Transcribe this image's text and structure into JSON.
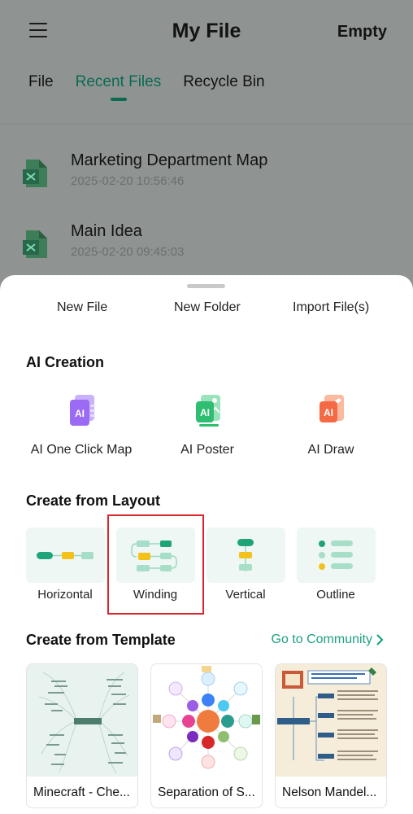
{
  "header": {
    "title": "My File",
    "empty_label": "Empty",
    "menu_icon": "menu-icon"
  },
  "tabs": [
    {
      "label": "File",
      "active": false
    },
    {
      "label": "Recent Files",
      "active": true
    },
    {
      "label": "Recycle Bin",
      "active": false
    }
  ],
  "files": [
    {
      "name": "Marketing Department Map",
      "time": "2025-02-20 10:56:46",
      "icon": "mindmap-file-icon"
    },
    {
      "name": "Main Idea",
      "time": "2025-02-20 09:45:03",
      "icon": "mindmap-file-icon"
    }
  ],
  "sheet": {
    "actions": {
      "new_file": "New File",
      "new_folder": "New Folder",
      "import": "Import File(s)"
    },
    "ai_creation": {
      "title": "AI Creation",
      "items": [
        {
          "label": "AI One Click Map",
          "icon": "ai-one-click-map-icon",
          "badge": "AI",
          "color": "#8a5cf0"
        },
        {
          "label": "AI Poster",
          "icon": "ai-poster-icon",
          "badge": "AI",
          "color": "#27b36b"
        },
        {
          "label": "AI Draw",
          "icon": "ai-draw-icon",
          "badge": "AI",
          "color": "#f0643f"
        }
      ]
    },
    "layout": {
      "title": "Create from Layout",
      "items": [
        {
          "label": "Horizontal",
          "selected": false
        },
        {
          "label": "Winding",
          "selected": true
        },
        {
          "label": "Vertical",
          "selected": false
        },
        {
          "label": "Outline",
          "selected": false
        }
      ]
    },
    "templates": {
      "title": "Create from Template",
      "community_link": "Go to Community",
      "items": [
        {
          "name": "Minecraft - Che..."
        },
        {
          "name": "Separation of S..."
        },
        {
          "name": "Nelson Mandel..."
        }
      ]
    }
  },
  "colors": {
    "accent": "#0a6b52",
    "link": "#1ea182",
    "highlight": "#d9262c",
    "layout_card_bg": "#eef7f3"
  }
}
